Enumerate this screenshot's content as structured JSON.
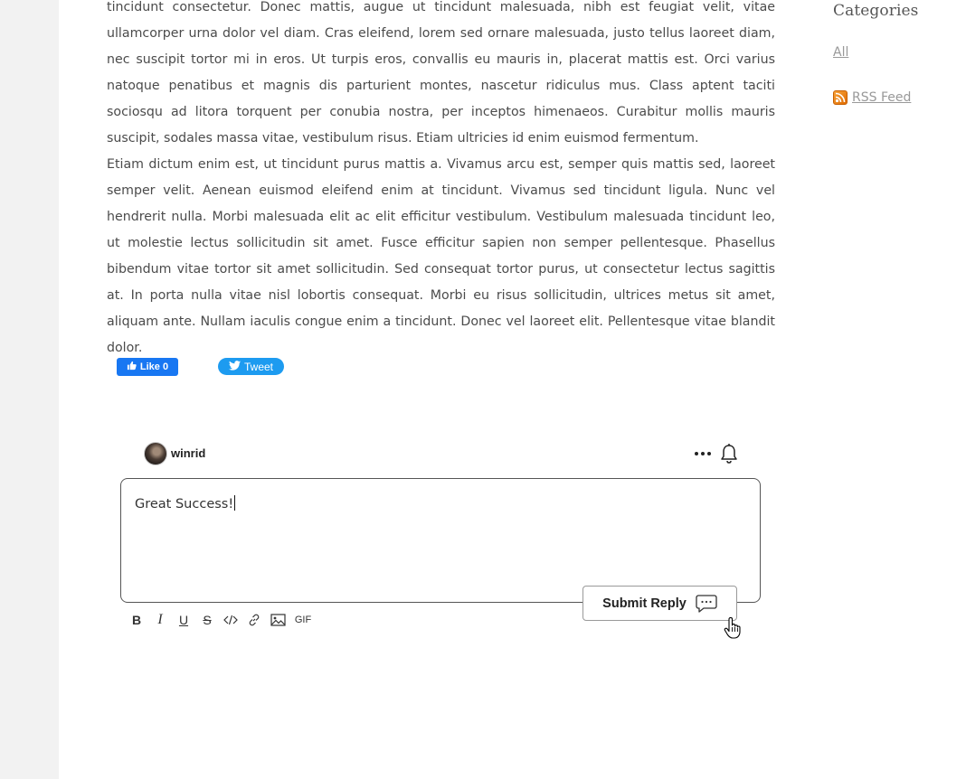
{
  "article": {
    "paragraphs": [
      "tincidunt consectetur. Donec mattis, augue ut tincidunt malesuada, nibh est feugiat velit, vitae ullamcorper urna dolor vel diam. Cras eleifend, lorem sed ornare malesuada, justo tellus laoreet diam, nec suscipit tortor mi in eros. Ut turpis eros, convallis eu mauris in, placerat mattis est. Orci varius natoque penatibus et magnis dis parturient montes, nascetur ridiculus mus. Class aptent taciti sociosqu ad litora torquent per conubia nostra, per inceptos himenaeos. Curabitur mollis mauris suscipit, sodales massa vitae, vestibulum risus. Etiam ultricies id enim euismod fermentum.",
      "Etiam dictum enim est, ut tincidunt purus mattis a. Vivamus arcu est, semper quis mattis sed, laoreet semper velit. Aenean euismod eleifend enim at tincidunt. Vivamus sed tincidunt ligula. Nunc vel hendrerit nulla. Morbi malesuada elit ac elit efficitur vestibulum. Vestibulum malesuada tincidunt leo, ut molestie lectus sollicitudin sit amet. Fusce efficitur sapien non semper pellentesque. Phasellus bibendum vitae tortor sit amet sollicitudin. Sed consequat tortor purus, ut consectetur lectus sagittis at. In porta nulla vitae nisl lobortis consequat. Morbi eu risus sollicitudin, ultrices metus sit amet, aliquam ante. Nullam iaculis congue enim a tincidunt. Donec vel laoreet elit. Pellentesque vitae blandit dolor."
    ]
  },
  "sidebar": {
    "heading": "Categories",
    "all_link": "All",
    "rss_link": "RSS Feed"
  },
  "social": {
    "like_label": "Like 0",
    "tweet_label": "Tweet"
  },
  "comment": {
    "username": "winrid",
    "editor_value": "Great Success!",
    "submit_label": "Submit Reply"
  },
  "toolbar": {
    "bold": "B",
    "italic": "I",
    "underline": "U",
    "strike": "S",
    "gif": "GIF"
  },
  "colors": {
    "facebook": "#1877f2",
    "twitter": "#1d9bf0",
    "gutter": "#f2f2f2"
  }
}
